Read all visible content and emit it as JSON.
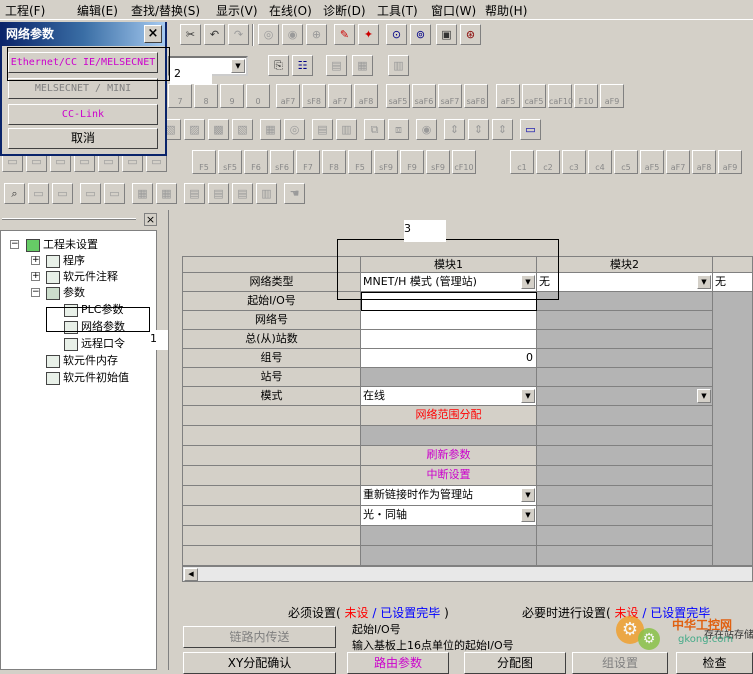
{
  "menubar": {
    "items": [
      "工程(F)",
      "编辑(E)",
      "查找/替换(S)",
      "显示(V)",
      "在线(O)",
      "诊断(D)",
      "工具(T)",
      "窗口(W)",
      "帮助(H)"
    ]
  },
  "dialog": {
    "title": "网络参数",
    "close": "×",
    "btn_ethernet": "Ethernet/CC IE/MELSECNET",
    "btn_melsecnet": "MELSECNET / MINI",
    "btn_cclink": "CC-Link",
    "btn_cancel": "取消"
  },
  "toolbar": {
    "fkeys_row1": [
      "aF7",
      "sF8",
      "aF7",
      "aF8",
      "saF5",
      "saF6",
      "saF7",
      "saF8",
      "aF5",
      "caF5",
      "caF10",
      "F10",
      "aF9"
    ],
    "fkeys_row1_top": [
      "7",
      "8",
      "9",
      "0"
    ],
    "fkeys_row2": [
      "F5",
      "sF5",
      "F6",
      "sF6",
      "F7",
      "F8",
      "F5",
      "sF9",
      "F9",
      "sF9",
      "cF10",
      "c1",
      "c2",
      "c3",
      "c4",
      "c5",
      "aF5",
      "aF7",
      "aF8",
      "aF9"
    ]
  },
  "annotations": {
    "label1": "1",
    "label2": "2",
    "label3": "3"
  },
  "tree": {
    "root": "工程未设置",
    "program": "程序",
    "device_comment": "软元件注释",
    "parameter": "参数",
    "plc_param": "PLC参数",
    "network_param": "网络参数",
    "remote_pw": "远程口令",
    "device_memory": "软元件内存",
    "device_init": "软元件初始值"
  },
  "grid": {
    "col_module1": "模块1",
    "col_module2": "模块2",
    "rows": [
      "网络类型",
      "起始I/O号",
      "网络号",
      "总(从)站数",
      "组号",
      "站号",
      "模式"
    ],
    "m1_network_type": "MNET/H 模式 (管理站)",
    "m2_network_type": "无",
    "m3_network_type": "无",
    "m1_group": "0",
    "m1_mode": "在线",
    "m1_range": "网络范围分配",
    "m1_refresh": "刷新参数",
    "m1_interrupt": "中断设置",
    "m1_relink": "重新链接时作为管理站",
    "m1_cable": "光・同轴",
    "accent_red": "#ff0000",
    "accent_magenta": "#cc00cc"
  },
  "footer": {
    "required_label": "必须设置(",
    "not_set": "未设",
    "slash": "/",
    "set_done": "已设置完毕",
    "close_paren": ")",
    "optional_label": "必要时进行设置(",
    "opt_not_set": "未设",
    "opt_set_done": "已设置完毕",
    "hint_title": "起始I/O号",
    "hint_body": "输入基板上16点单位的起始I/O号",
    "link_transfer": "链路内传送",
    "xy_assign": "XY分配确认",
    "route_param": "路由参数",
    "assign_chart": "分配图",
    "group_setting": "组设置",
    "check": "检查",
    "truncated_right": "存在站存储",
    "watermark": "中华工控网",
    "watermark_url": "gkong.com"
  }
}
